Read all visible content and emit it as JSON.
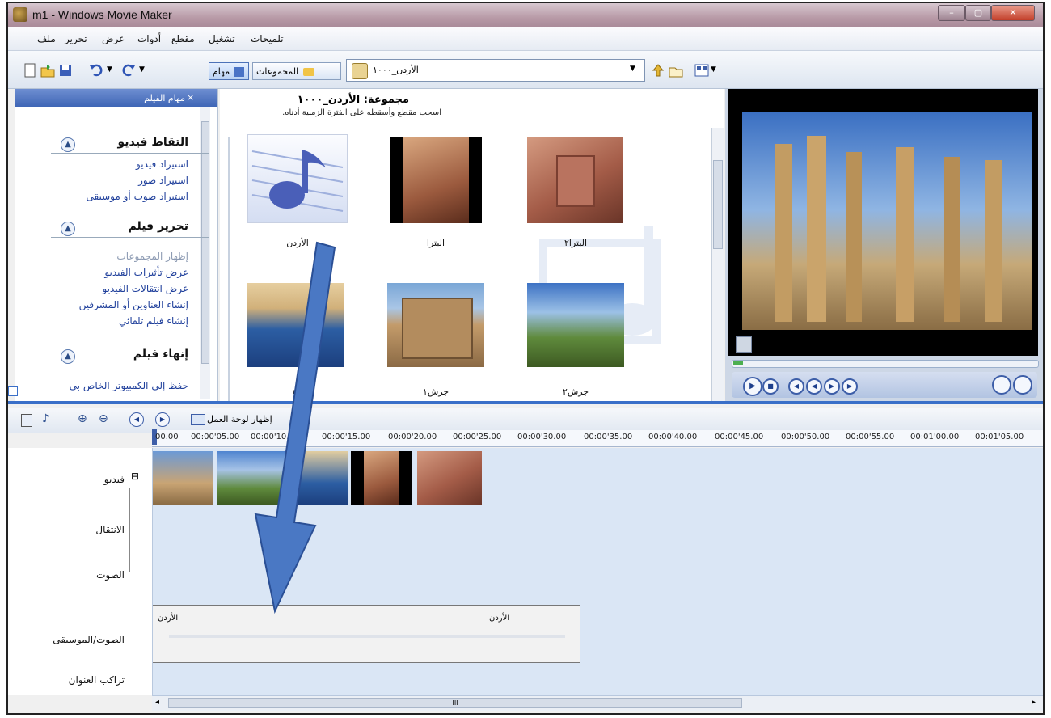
{
  "window": {
    "title": "m1 - Windows Movie Maker",
    "minimize": "–",
    "maximize": "▢",
    "close": "✕"
  },
  "menu": [
    "ملف",
    "تحرير",
    "عرض",
    "أدوات",
    "مقطع",
    "تشغيل",
    "تلميحات"
  ],
  "toolbar": {
    "tasks_label": "مهام",
    "collections_label": "المجموعات",
    "current_collection": "الأردن_١٠٠٠"
  },
  "tasks_pane": {
    "header": "مهام الفيلم",
    "close": "×",
    "sections": [
      {
        "title": "التقاط فيديو",
        "links": [
          "استيراد فيديو",
          "استيراد صور",
          "استيراد صوت أو موسيقى"
        ]
      },
      {
        "title": "تحرير فيلم",
        "links": [
          "إظهار المجموعات",
          "عرض تأثيرات الفيديو",
          "عرض انتقالات الفيديو",
          "إنشاء العناوين أو المشرفين",
          "إنشاء فيلم تلقائي"
        ]
      },
      {
        "title": "إنهاء فيلم",
        "links": [
          "حفظ إلى الكمبيوتر الخاص بي"
        ]
      }
    ]
  },
  "collection": {
    "title": "مجموعة: الأردن_١٠٠٠",
    "hint": ".اسحب مقطع وأسقطه على الفترة الزمنية أدناه",
    "items": [
      {
        "label": "الأردن"
      },
      {
        "label": "البترا"
      },
      {
        "label": "البترا٢"
      },
      {
        "label": "١ة"
      },
      {
        "label": "جرش١"
      },
      {
        "label": "جرش٢"
      }
    ]
  },
  "timeline": {
    "storyboard_label": "إظهار لوحة العمل",
    "ruler": [
      "00.00",
      "00:00'05.00",
      "00:00'10.00",
      "00:00'15.00",
      "00:00'20.00",
      "00:00'25.00",
      "00:00'30.00",
      "00:00'35.00",
      "00:00'40.00",
      "00:00'45.00",
      "00:00'50.00",
      "00:00'55.00",
      "00:01'00.00",
      "00:01'05.00"
    ],
    "tracks": [
      "فيديو",
      "الانتقال",
      "الصوت",
      "الصوت/الموسيقى",
      "تراكب العنوان"
    ],
    "audio_clip_labels": [
      "الأردن",
      "الأردن"
    ],
    "expand_toggle": "⊟"
  },
  "scrollbar": {
    "grip": "III"
  }
}
